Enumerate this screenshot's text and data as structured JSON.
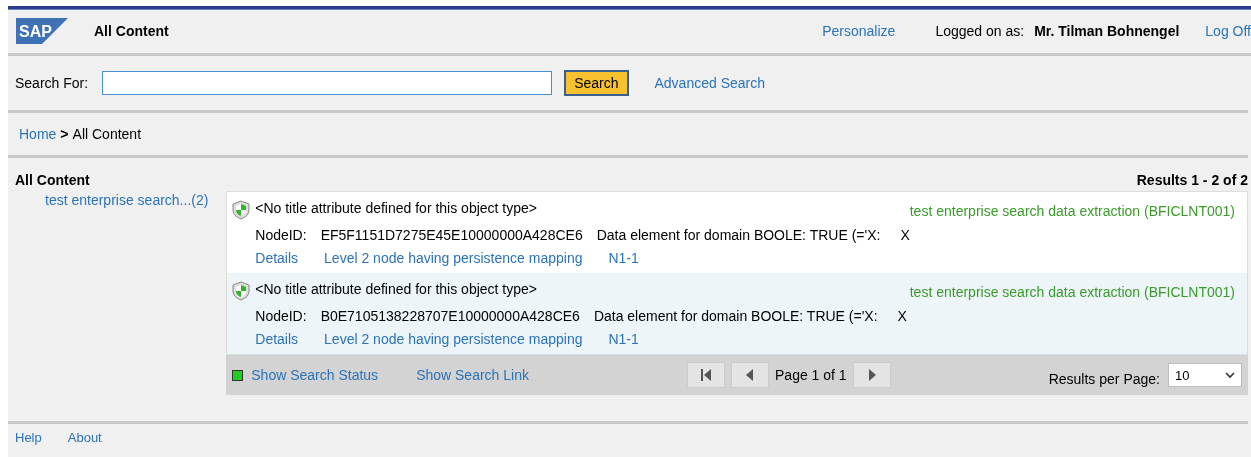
{
  "header": {
    "logo": "SAP",
    "title": "All Content",
    "personalize": "Personalize",
    "logged_label": "Logged on as:",
    "user": "Mr. Tilman Bohnengel",
    "logoff": "Log Off"
  },
  "search": {
    "label": "Search For:",
    "button": "Search",
    "advanced": "Advanced Search"
  },
  "breadcrumb": {
    "home": "Home",
    "separator": ">",
    "current": "All Content"
  },
  "sidebar": {
    "title": "All Content",
    "items": [
      {
        "label": "test enterprise search...(2)"
      }
    ]
  },
  "results": {
    "summary": "Results 1 - 2 of 2",
    "items": [
      {
        "selected": false,
        "title": "<No title attribute defined for this object type>",
        "source": "test enterprise search data extraction (BFICLNT001)",
        "id_label": "NodeID:",
        "id": "EF5F1151D7275E45E10000000A428CE6",
        "description": "Data element for domain BOOLE: TRUE (='X:",
        "value": "X",
        "links": [
          "Details",
          "Level 2 node having persistence mapping",
          "N1-1"
        ]
      },
      {
        "selected": true,
        "title": "<No title attribute defined for this object type>",
        "source": "test enterprise search data extraction (BFICLNT001)",
        "id_label": "NodeID:",
        "id": "B0E7105138228707E10000000A428CE6",
        "description": "Data element for domain BOOLE: TRUE (='X:",
        "value": "X",
        "links": [
          "Details",
          "Level 2 node having persistence mapping",
          "N1-1"
        ]
      }
    ]
  },
  "footer_bar": {
    "status": {
      "label": "Show Search Status",
      "color": "#22cc22"
    },
    "link": "Show Search Link",
    "page": "Page 1 of 1",
    "per_page_label": "Results per Page:",
    "per_page": "10"
  },
  "footer": {
    "links": [
      "Help",
      "About"
    ]
  }
}
